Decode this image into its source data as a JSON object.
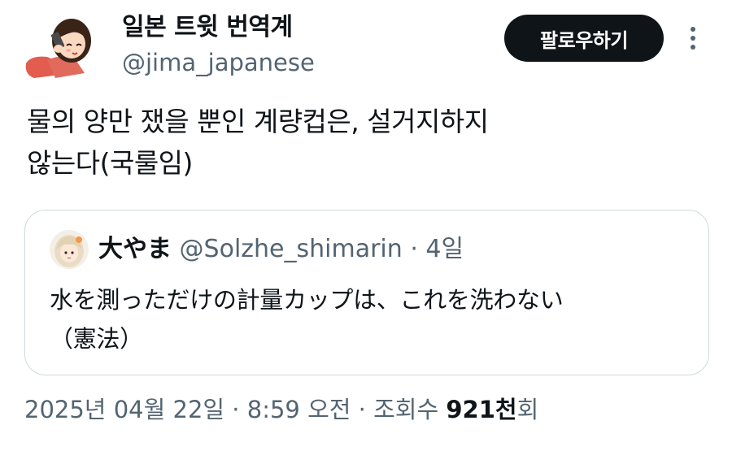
{
  "author": {
    "display_name": "일본 트윗 번역계",
    "handle": "@jima_japanese",
    "avatar_icon": "phone-girl-avatar-icon"
  },
  "follow_label": "팔로우하기",
  "more_icon": "more-vertical-icon",
  "tweet": {
    "line1": "물의 양만 쟀을 뿐인 계량컵은, 설거지하지",
    "line2": "않는다(국룰임)"
  },
  "quote": {
    "avatar_icon": "anime-girl-avatar-icon",
    "name": "大やま",
    "handle": "@Solzhe_shimarin",
    "dot": "·",
    "time": "4일",
    "line1": "水を測っただけの計量カップは、これを洗わない",
    "line2": "（憲法）"
  },
  "meta": {
    "date": "2025년 04월 22일",
    "sep1": " · ",
    "time": "8:59 오전",
    "sep2": " · 조회수 ",
    "views_number": "921천",
    "views_suffix": "회"
  },
  "colors": {
    "text": "#0f1419",
    "secondary": "#536471",
    "border": "#cfd9de",
    "follow_bg": "#0f1419"
  }
}
